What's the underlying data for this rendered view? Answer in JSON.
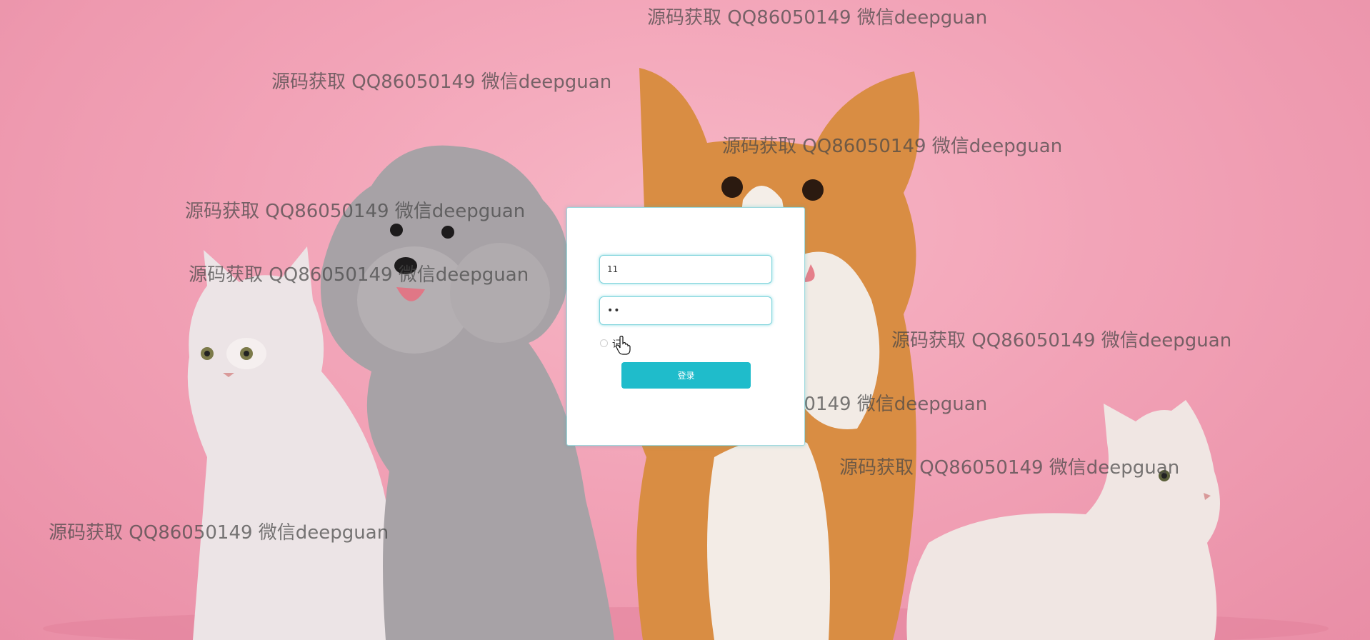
{
  "background": {
    "description_color": "#f2a4b8"
  },
  "watermarks": [
    "源码获取 QQ86050149 微信deepguan",
    "源码获取 QQ86050149 微信deepguan",
    "源码获取 QQ86050149 微信deepguan",
    "源码获取 QQ86050149 微信deepguan",
    "源码获取 QQ86050149 微信deepguan",
    "源码获取 QQ86050149 微信deepguan",
    "源码获取 QQ86050149 微信deepguan",
    "源码获取 QQ86050149 微信deepguan",
    "源码获取 QQ86050149 微信deepguan"
  ],
  "login": {
    "username_value": "11",
    "password_value": "••",
    "remember_label": "记",
    "submit_label": "登录"
  },
  "colors": {
    "accent": "#1fbccb",
    "field_border": "#7fd3dc"
  },
  "icons": {
    "cursor": "hand-pointer-icon"
  }
}
